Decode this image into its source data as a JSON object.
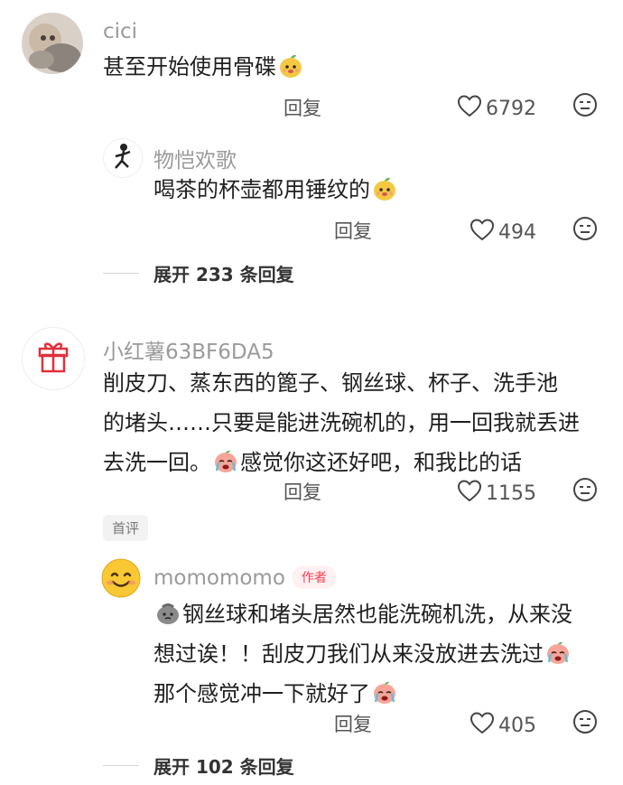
{
  "comments": [
    {
      "username": "cici",
      "text_lines": [
        "甚至开始使用骨碟"
      ],
      "reply_label": "回复",
      "likes": "6792",
      "replies": [
        {
          "username": "物恺欢歌",
          "text_lines": [
            "喝茶的杯壶都用锤纹的"
          ],
          "reply_label": "回复",
          "likes": "494"
        }
      ],
      "expand_label": "展开 233 条回复"
    },
    {
      "username": "小红薯63BF6DA5",
      "text_lines": [
        "削皮刀、蒸东西的篦子、钢丝球、杯子、洗手池",
        "的堵头……只要是能进洗碗机的，用一回我就丢进",
        "去洗一回。",
        "感觉你这还好吧，和我比的话"
      ],
      "reply_label": "回复",
      "likes": "1155",
      "badge": "首评",
      "replies": [
        {
          "username": "momomomo",
          "author_badge": "作者",
          "text_lines": [
            "钢丝球和堵头居然也能洗碗机洗，从来没",
            "想过诶！！刮皮刀我们从来没放进去洗过",
            "那个感觉冲一下就好了"
          ],
          "reply_label": "回复",
          "likes": "405"
        }
      ],
      "expand_label": "展开 102 条回复"
    }
  ],
  "icons": {
    "like": "heart-outline-icon",
    "dislike": "unhappy-face-icon"
  }
}
